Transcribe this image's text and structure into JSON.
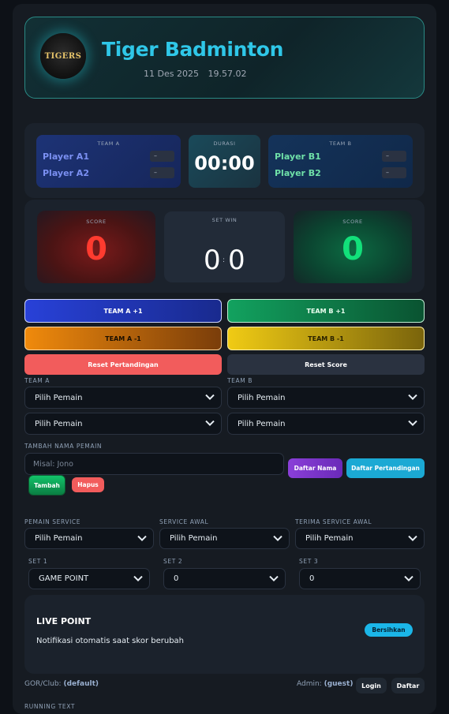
{
  "header": {
    "logo_text": "TIGERS",
    "title": "Tiger Badminton",
    "date": "11 Des 2025",
    "time": "19.57.02"
  },
  "match": {
    "team_a_label": "TEAM A",
    "team_b_label": "TEAM B",
    "duration_label": "DURASI",
    "duration": "00:00",
    "team_a_players": [
      "Player A1",
      "Player A2"
    ],
    "team_b_players": [
      "Player B1",
      "Player B2"
    ],
    "player_score_placeholder": "–"
  },
  "scoreboard": {
    "score_label": "SCORE",
    "set_win_label": "SET WIN",
    "score_a": "0",
    "score_b": "0",
    "set_win_a": "0",
    "set_win_sep": ":",
    "set_win_b": "0",
    "score_a_color": "#ff3b2f",
    "score_b_color": "#12e07a"
  },
  "controls": {
    "team_a_plus": "TEAM A +1",
    "team_b_plus": "TEAM B +1",
    "team_a_minus": "TEAM A -1",
    "team_b_minus": "TEAM B -1",
    "reset_match": "Reset Pertandingan",
    "reset_score": "Reset Score"
  },
  "players_select": {
    "team_a_label": "TEAM A",
    "team_b_label": "TEAM B",
    "placeholder": "Pilih Pemain"
  },
  "add_player": {
    "label": "TAMBAH NAMA PEMAIN",
    "input_placeholder": "Misal: Jono",
    "daftar_nama": "Daftar Nama",
    "daftar_pertandingan": "Daftar Pertandingan",
    "tambah": "Tambah",
    "hapus": "Hapus"
  },
  "service": {
    "pemain_service_label": "PEMAIN SERVICE",
    "service_awal_label": "SERVICE AWAL",
    "terima_service_label": "TERIMA SERVICE AWAL",
    "pemain_service_value": "Pilih Pemain",
    "service_awal_value": "Pilih Pemain",
    "terima_service_value": "Pilih Pemain"
  },
  "sets": {
    "set1_label": "SET 1",
    "set2_label": "SET 2",
    "set3_label": "SET 3",
    "set1_value": "GAME POINT",
    "set2_value": "0",
    "set3_value": "0"
  },
  "live_point": {
    "title": "LIVE POINT",
    "description": "Notifikasi otomatis saat skor berubah",
    "clear_button": "Bersihkan"
  },
  "footer": {
    "club_label": "GOR/Club:",
    "club_value": "(default)",
    "admin_label": "Admin:",
    "admin_value": "(guest)",
    "login": "Login",
    "daftar": "Daftar",
    "running_text_label": "RUNNING TEXT"
  }
}
